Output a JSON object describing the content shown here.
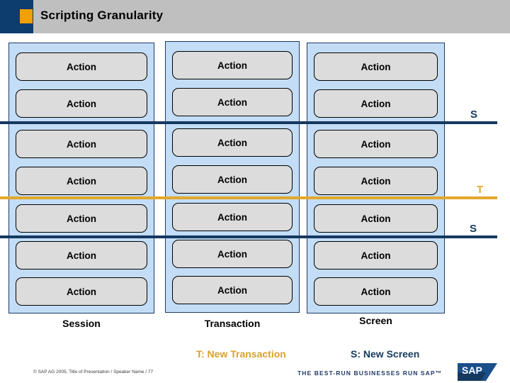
{
  "header": {
    "title": "Scripting Granularity",
    "navy_color": "#0d3c6e",
    "accent_color": "#f0a000",
    "band_color": "#bfbfbf"
  },
  "diagram": {
    "column_fill": "#c3ddf7",
    "column_border": "#1f3864",
    "action_fill": "#dcdcdc",
    "action_label": "Action",
    "columns": [
      {
        "id": "session",
        "caption": "Session",
        "actions": [
          "Action",
          "Action",
          "Action",
          "Action",
          "Action",
          "Action",
          "Action"
        ]
      },
      {
        "id": "transaction",
        "caption": "Transaction",
        "actions": [
          "Action",
          "Action",
          "Action",
          "Action",
          "Action",
          "Action",
          "Action"
        ]
      },
      {
        "id": "screen",
        "caption": "Screen",
        "actions": [
          "Action",
          "Action",
          "Action",
          "Action",
          "Action",
          "Action",
          "Action"
        ]
      }
    ],
    "separators": [
      {
        "id": "s1",
        "label": "S",
        "color": "#15395f"
      },
      {
        "id": "t",
        "label": "T",
        "color": "#e3a82b"
      },
      {
        "id": "s2",
        "label": "S",
        "color": "#15395f"
      }
    ]
  },
  "legend": {
    "transaction": "T: New Transaction",
    "transaction_color": "#d8a22a",
    "screen": "S: New Screen",
    "screen_color": "#15395f"
  },
  "footer": {
    "copyright": "© SAP AG 2005, Title of Presentation / Speaker Name / 77",
    "tagline": "THE BEST-RUN BUSINESSES RUN SAP™",
    "logo_text": "SAP"
  }
}
